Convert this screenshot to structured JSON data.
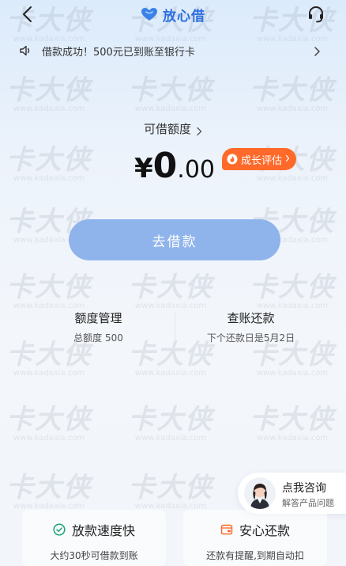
{
  "nav": {
    "back_icon": "chevron-left-icon",
    "brand_name": "放心借",
    "service_icon": "headset-icon"
  },
  "notice": {
    "text": "借款成功！500元已到账至银行卡"
  },
  "credit": {
    "label": "可借额度",
    "currency": "¥",
    "amount_int": "0",
    "amount_dec": ".00",
    "badge": "成长评估"
  },
  "borrow_button": {
    "label": "去借款"
  },
  "cards": [
    {
      "title": "额度管理",
      "subtitle": "总额度 500"
    },
    {
      "title": "查账还款",
      "subtitle": "下个还款日是5月2日"
    }
  ],
  "consult": {
    "title": "点我咨询",
    "subtitle": "解答产品问题"
  },
  "features": [
    {
      "title": "放款速度快",
      "subtitle": "大约30秒可借款到账",
      "icon": "clock-icon"
    },
    {
      "title": "安心还款",
      "subtitle": "还款有提醒,到期自动扣",
      "icon": "wallet-icon"
    }
  ],
  "watermark": {
    "text": "卡大侠",
    "site": "www.kadaxia.com"
  },
  "colors": {
    "brand_blue": "#2d6fe0",
    "button_blue": "#8fb4ec",
    "badge_orange": "#ff6a2a",
    "feature_green": "#1aa37a",
    "feature_orange": "#ff6a2a"
  }
}
